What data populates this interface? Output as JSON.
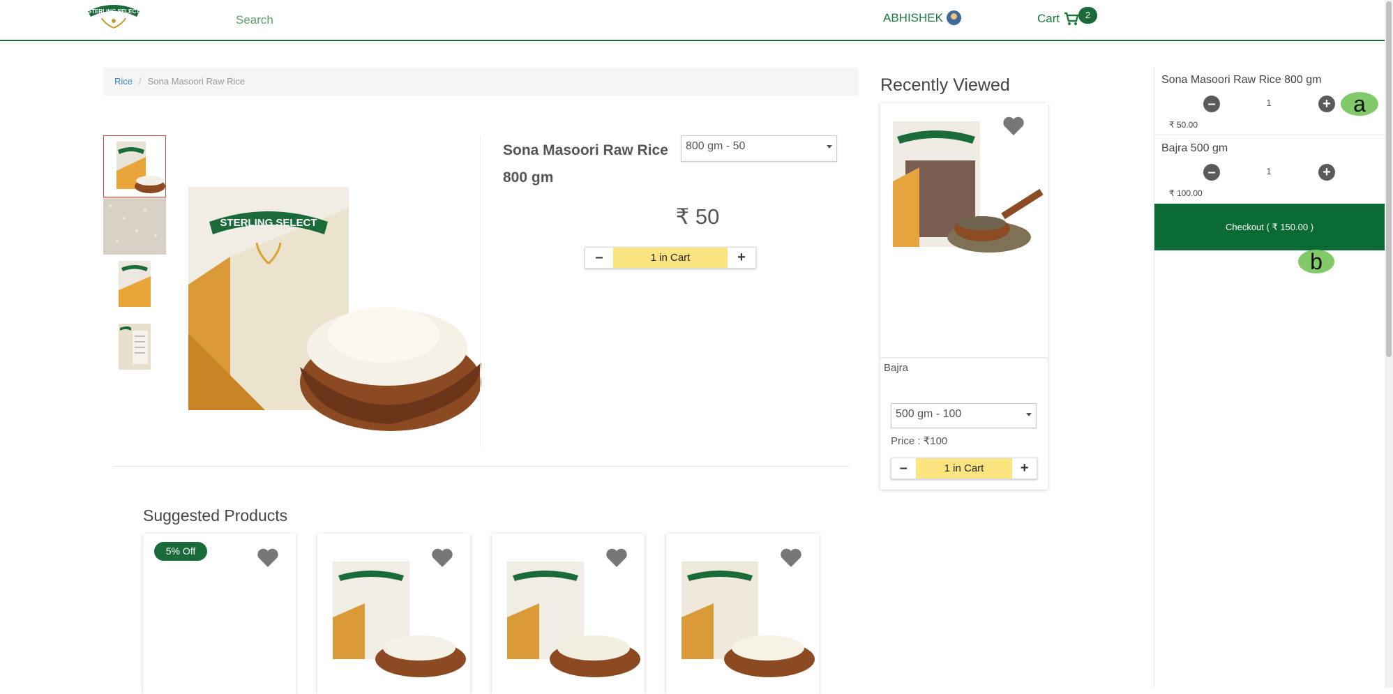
{
  "header": {
    "logo_text": "STERLING SELECT",
    "search_placeholder": "Search",
    "user_name": "ABHISHEK",
    "cart_label": "Cart",
    "cart_count": "2"
  },
  "breadcrumb": {
    "category": "Rice",
    "current": "Sona Masoori Raw Rice"
  },
  "product": {
    "title": "Sona Masoori Raw Rice 800 gm",
    "variant_selected": "800 gm - 50",
    "price": "₹ 50",
    "qty_minus": "–",
    "qty_label": "1 in Cart",
    "qty_plus": "+"
  },
  "recently_viewed": {
    "title": "Recently Viewed",
    "item": {
      "name": "Bajra",
      "variant_selected": "500 gm - 100",
      "price": "Price : ₹100",
      "qty_minus": "–",
      "qty_label": "1 in Cart",
      "qty_plus": "+"
    }
  },
  "suggested": {
    "title": "Suggested Products",
    "discount_badge": "5% Off"
  },
  "cart_panel": {
    "items": [
      {
        "name": "Sona Masoori Raw Rice 800 gm",
        "qty": "1",
        "price": "₹ 50.00"
      },
      {
        "name": "Bajra 500 gm",
        "qty": "1",
        "price": "₹ 100.00"
      }
    ],
    "checkout_label": "Checkout ( ₹ 150.00 )"
  },
  "annotations": {
    "mark_a": "a",
    "mark_b": "b"
  },
  "colors": {
    "brand_green": "#0b6b35",
    "qty_yellow": "#fce480",
    "link_blue": "#2f86c6"
  }
}
